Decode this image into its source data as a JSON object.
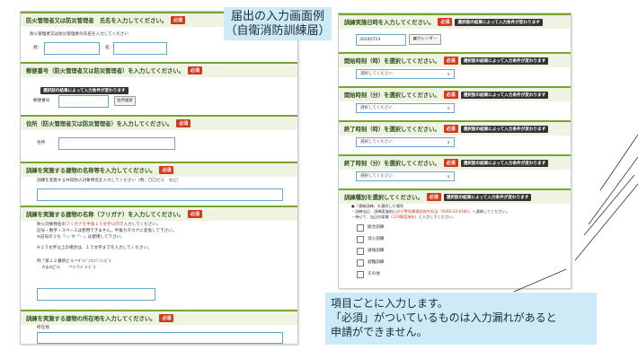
{
  "caption": {
    "line1": "届出の入力画面例",
    "line2": "（自衛消防訓練届）"
  },
  "note": {
    "line1": "項目ごとに入力します。",
    "line2": "「必須」がついているものは入力漏れがあると",
    "line3": "申請ができません。"
  },
  "left": {
    "sections": {
      "manager": {
        "title": "防火管理者又は防災管理者　氏名を入力してください。",
        "required": "必須",
        "instruction": "防火管理者又は防災管理者の氏名を入力してください",
        "surname_label": "姓：",
        "name_label": "名："
      },
      "postal": {
        "title": "郵便番号（防火管理者又は防災管理者）を入力してください。",
        "required": "必須",
        "note": "選択肢の結果によって入力条件が変わります",
        "field_label": "郵便番号",
        "search_button": "住所検索"
      },
      "address": {
        "title": "住所（防火管理者又は防災管理者）を入力してください。",
        "required": "必須",
        "field_label": "住所"
      },
      "bldg_name": {
        "title": "訓練を実施する建物の名称等を入力してください。",
        "required": "必須",
        "instruction": "訓練を実施する共同防火対象物名を入力してください（例：〇〇ビル　など）"
      },
      "bldg_kana": {
        "title": "訓練を実施する建物の名称（フリガナ）を入力してください。",
        "required": "必須",
        "line1_a": "防火対象物名の",
        "line1_red": "フリガナを半角１５文字以内",
        "line1_b": "で入力してください。",
        "line2": "記号・数字・スペースは使用できません。半角カタカナに変換して下さい。",
        "line3": "※記号のうち「ｰ」や「･･」は使用して下さい。",
        "line4": "※１５文字以上の場合は、１５文字までを入力してください。",
        "line5": "例「第１２番新ビル＝ﾀﾞｲｼﾞｭｳﾆﾊﾞﾝｼﾝﾋﾞﾙ",
        "line6": "　 A＆Aビル　　＝ｴｰｱﾝﾄﾞｴｰﾋﾞﾙ"
      },
      "bldg_address": {
        "title": "訓練を実施する建物の所在地を入力してください。",
        "required": "必須",
        "field_label": "所在地"
      }
    }
  },
  "right": {
    "sections": {
      "date": {
        "title": "訓練実施日時を入力してください。",
        "required": "必須",
        "note": "選択肢の結果によって入力条件が変わります",
        "date_value": "20240723",
        "calendar_label": "カレンダー"
      },
      "start_hour": {
        "title": "開始時刻（時）を選択してください。",
        "required": "必須",
        "note": "選択肢の結果によって入力条件が変わります",
        "placeholder": "選択してください"
      },
      "start_min": {
        "title": "開始時刻（分）を選択してください。",
        "required": "必須",
        "note": "選択肢の結果によって入力条件が変わります",
        "placeholder": "選択してください"
      },
      "end_hour": {
        "title": "終了時刻（時）を選択してください。",
        "required": "必須",
        "note": "選択肢の結果によって入力条件が変わります",
        "placeholder": "選択してください"
      },
      "end_min": {
        "title": "終了時刻（分）を選択してください。",
        "required": "必須",
        "note": "選択肢の結果によって入力条件が変わります",
        "placeholder": "選択してください"
      },
      "type": {
        "title": "訓練種別を選択してください。",
        "required": "必須",
        "note": "選択肢の結果によって入力条件が変わります",
        "info1": "●「通報訓練」を選択した場合",
        "info2_a": "・訓練当日、訓練実施前に",
        "info2_red": "必ず警防課通信指令担当『0466-22-0182』",
        "info2_b": "へ連絡してください。",
        "info3_a": "・券せて、当日の架電（",
        "info3_red": "119番実施先",
        "info3_b": "）と入力してください。",
        "options": [
          "総合訓練",
          "消火訓練",
          "通報訓練",
          "避難訓練",
          "その他"
        ]
      }
    }
  }
}
